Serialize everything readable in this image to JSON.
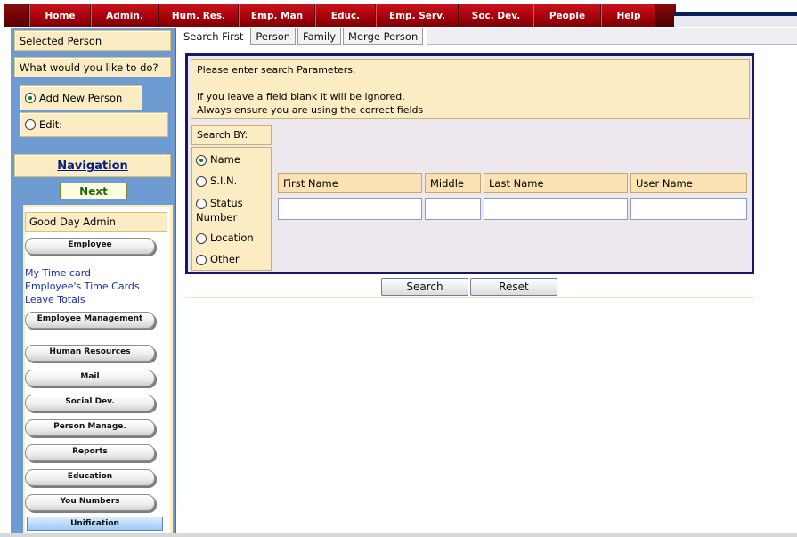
{
  "topnav": {
    "items": [
      "Home",
      "Admin.",
      "Hum. Res.",
      "Emp. Man",
      "Educ.",
      "Emp. Serv.",
      "Soc. Dev.",
      "People",
      "Help"
    ],
    "color": "#b3000c"
  },
  "sidebar": {
    "selected_person": "Selected Person",
    "what_to_do": "What would you like to do?",
    "add_new_person": "Add New Person",
    "edit": "Edit:",
    "navigation": "Navigation",
    "next": "Next",
    "greeting": "Good Day Admin",
    "employee_pill": "Employee",
    "links": [
      "My Time card",
      "Employee's Time Cards",
      "Leave Totals"
    ],
    "pills": [
      "Employee Management",
      "Human Resources",
      "Mail",
      "Social Dev.",
      "Person Manage.",
      "Reports",
      "Education",
      "You Numbers"
    ],
    "unification": "Unification"
  },
  "tabs": [
    "Search First",
    "Person",
    "Family",
    "Merge Person"
  ],
  "search": {
    "info_line1": "Please enter search Parameters.",
    "info_line2": "If you leave a field blank it will be ignored.",
    "info_line3": "Always ensure you are using the correct fields",
    "search_by": "Search BY:",
    "options": [
      "Name",
      "S.I.N.",
      "Status Number",
      "Location",
      "Other"
    ],
    "selected_option": "Name",
    "columns": [
      "First Name",
      "Middle",
      "Last Name",
      "User Name"
    ],
    "values": [
      "",
      "",
      "",
      ""
    ]
  },
  "buttons": {
    "search": "Search",
    "reset": "Reset"
  }
}
